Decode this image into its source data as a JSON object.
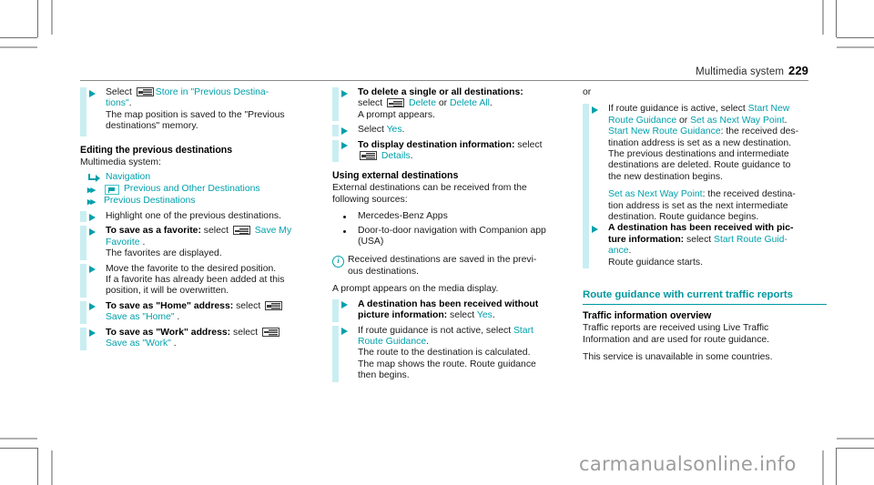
{
  "header": {
    "title": "Multimedia system",
    "page_number": "229"
  },
  "colors": {
    "teal": "#00a0ab",
    "heading_teal": "#00989f",
    "bar": "#c9eef2",
    "watermark": "#9d9d9d"
  },
  "column1": {
    "step_select": {
      "lead": "Select",
      "icon": "ok-button-icon",
      "link": "Store in \"Previous Destina-",
      "link_line2": "tions\"",
      "trailing": ".",
      "result_line1": "The map position is saved to the \"Previous",
      "result_line2": "destinations\" memory."
    },
    "heading_editing": "Editing the previous destinations",
    "device_label": "Multimedia system:",
    "breadcrumb": [
      {
        "icon": "nav-arrow-icon",
        "label": "Navigation"
      },
      {
        "icon": "chevron-double-icon",
        "glyph": "flag-box-icon",
        "label": "Previous and Other Destinations"
      },
      {
        "icon": "chevron-double-icon",
        "label": "Previous Destinations"
      }
    ],
    "step_highlight": "Highlight one of the previous destinations.",
    "step_favorite": {
      "bold": "To save as a favorite:",
      "lead": " select",
      "icon": "ok-button-icon",
      "link": "Save My",
      "link_line2": "Favorite",
      "trailing": ".",
      "result": "The favorites are displayed."
    },
    "step_move": {
      "line1": "Move the favorite to the desired position.",
      "line2": "If a favorite has already been added at this",
      "line3": "position, it will be overwritten."
    },
    "step_home": {
      "bold": "To save as \"Home\" address:",
      "lead": " select",
      "icon": "ok-button-icon",
      "link": "Save as \"Home\"",
      "trailing": "."
    },
    "step_work": {
      "bold": "To save as \"Work\" address:",
      "lead": " select",
      "icon": "ok-button-icon",
      "link": "Save as \"Work\"",
      "trailing": "."
    }
  },
  "column2": {
    "step_delete": {
      "bold": "To delete a single or all destinations:",
      "lead": "select",
      "icon": "ok-button-icon",
      "link1": "Delete",
      "mid": " or ",
      "link2": "Delete All",
      "trailing": ".",
      "result": "A prompt appears."
    },
    "step_yes": {
      "lead": "Select ",
      "link": "Yes",
      "trailing": "."
    },
    "step_details": {
      "bold": "To display destination information:",
      "lead": " select",
      "icon": "ok-button-icon",
      "link": "Details",
      "trailing": "."
    },
    "heading_external": "Using external destinations",
    "external_intro_l1": "External destinations can be received from the",
    "external_intro_l2": "following sources:",
    "sources": [
      "Mercedes-Benz Apps",
      "Door-to-door navigation with Companion app",
      "(USA)"
    ],
    "note": {
      "icon": "info-icon",
      "line1": "Received destinations are saved in the previ-",
      "line2": "ous destinations."
    },
    "prompt_line": "A prompt appears on the media display.",
    "step_received_nopic": {
      "bold_l1": "A destination has been received without",
      "bold_l2": "picture information:",
      "lead": " select ",
      "link": "Yes",
      "trailing": "."
    },
    "step_not_active": {
      "line1_pre": "If route guidance is not active, select ",
      "link1": "Start",
      "link2": "Route Guidance",
      "trailing": ".",
      "result1": "The route to the destination is calculated.",
      "result2": "The map shows the route. Route guidance",
      "result3": "then begins."
    }
  },
  "column3": {
    "or_label": "or",
    "step_active": {
      "line1_pre": "If route guidance is active, select ",
      "link1": "Start New",
      "link2": "Route Guidance",
      "mid": " or ",
      "link3": "Set as Next Way Point",
      "trailing": ".",
      "desc_link": "Start New Route Guidance",
      "desc_l1": ": the received des-",
      "desc_l2": "tination address is set as a new destination.",
      "desc_l3": "The previous destinations and intermediate",
      "desc_l4": "destinations are deleted. Route guidance to",
      "desc_l5": "the new destination begins.",
      "desc2_link": "Set as Next Way Point",
      "desc2_l1": ": the received destina-",
      "desc2_l2": "tion address is set as the next intermediate",
      "desc2_l3": "destination. Route guidance begins."
    },
    "step_received_pic": {
      "bold_l1": "A destination has been received with pic-",
      "bold_l2": "ture information:",
      "lead": " select ",
      "link1": "Start Route Guid-",
      "link2": "ance",
      "trailing": ".",
      "result": "Route guidance starts."
    },
    "section_heading": "Route guidance with current traffic reports",
    "sub_heading": "Traffic information overview",
    "body_l1": "Traffic reports are received using Live Traffic",
    "body_l2": "Information and are used for route guidance.",
    "body_l3": "This service is unavailable in some countries."
  },
  "watermark": "carmanualsonline.info"
}
